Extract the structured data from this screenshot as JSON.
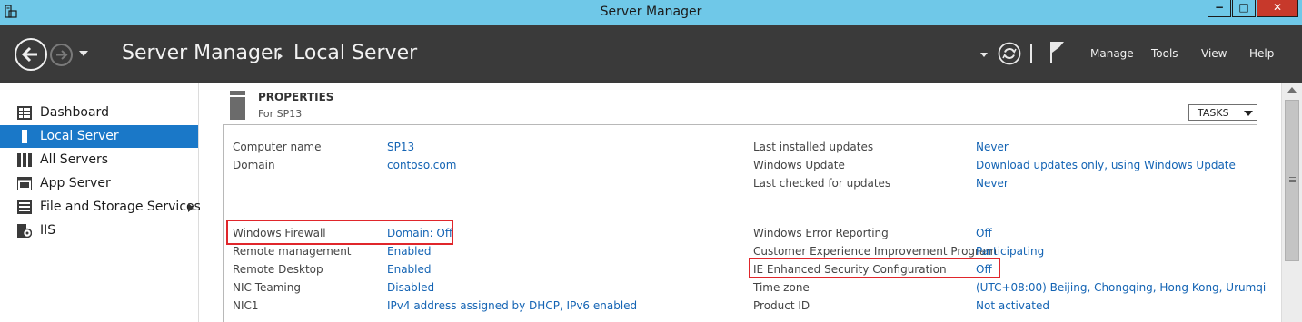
{
  "window": {
    "title": "Server Manager",
    "buttons": {
      "min": "−",
      "max": "□",
      "close": "✕"
    }
  },
  "header": {
    "breadcrumb_app": "Server Manager",
    "breadcrumb_page": "Local Server",
    "menu": [
      "Manage",
      "Tools",
      "View",
      "Help"
    ]
  },
  "sidebar": {
    "items": [
      {
        "label": "Dashboard",
        "icon": "dashboard-icon",
        "selected": false
      },
      {
        "label": "Local Server",
        "icon": "local-server-icon",
        "selected": true
      },
      {
        "label": "All Servers",
        "icon": "all-servers-icon",
        "selected": false
      },
      {
        "label": "App Server",
        "icon": "app-server-icon",
        "selected": false
      },
      {
        "label": "File and Storage Services",
        "icon": "file-storage-icon",
        "selected": false,
        "has_submenu": true
      },
      {
        "label": "IIS",
        "icon": "iis-icon",
        "selected": false
      }
    ]
  },
  "properties": {
    "title": "PROPERTIES",
    "subtitle": "For SP13",
    "tasks_label": "TASKS",
    "left_rows": [
      {
        "label": "Computer name",
        "value": "SP13"
      },
      {
        "label": "Domain",
        "value": "contoso.com"
      },
      {
        "label": "Windows Firewall",
        "value": "Domain: Off",
        "highlighted": true
      },
      {
        "label": "Remote management",
        "value": "Enabled"
      },
      {
        "label": "Remote Desktop",
        "value": "Enabled"
      },
      {
        "label": "NIC Teaming",
        "value": "Disabled"
      },
      {
        "label": "NIC1",
        "value": "IPv4 address assigned by DHCP, IPv6 enabled"
      }
    ],
    "right_rows": [
      {
        "label": "Last installed updates",
        "value": "Never"
      },
      {
        "label": "Windows Update",
        "value": "Download updates only, using Windows Update"
      },
      {
        "label": "Last checked for updates",
        "value": "Never"
      },
      {
        "label": "Windows Error Reporting",
        "value": "Off"
      },
      {
        "label": "Customer Experience Improvement Program",
        "value": "Participating"
      },
      {
        "label": "IE Enhanced Security Configuration",
        "value": "Off",
        "highlighted": true
      },
      {
        "label": "Time zone",
        "value": "(UTC+08:00) Beijing, Chongqing, Hong Kong, Urumqi"
      },
      {
        "label": "Product ID",
        "value": "Not activated"
      }
    ]
  },
  "colors": {
    "titlebar": "#6fc8e8",
    "header": "#3a3a3a",
    "selected": "#1a78c8",
    "link": "#1464b4",
    "highlight": "#e0262b"
  }
}
